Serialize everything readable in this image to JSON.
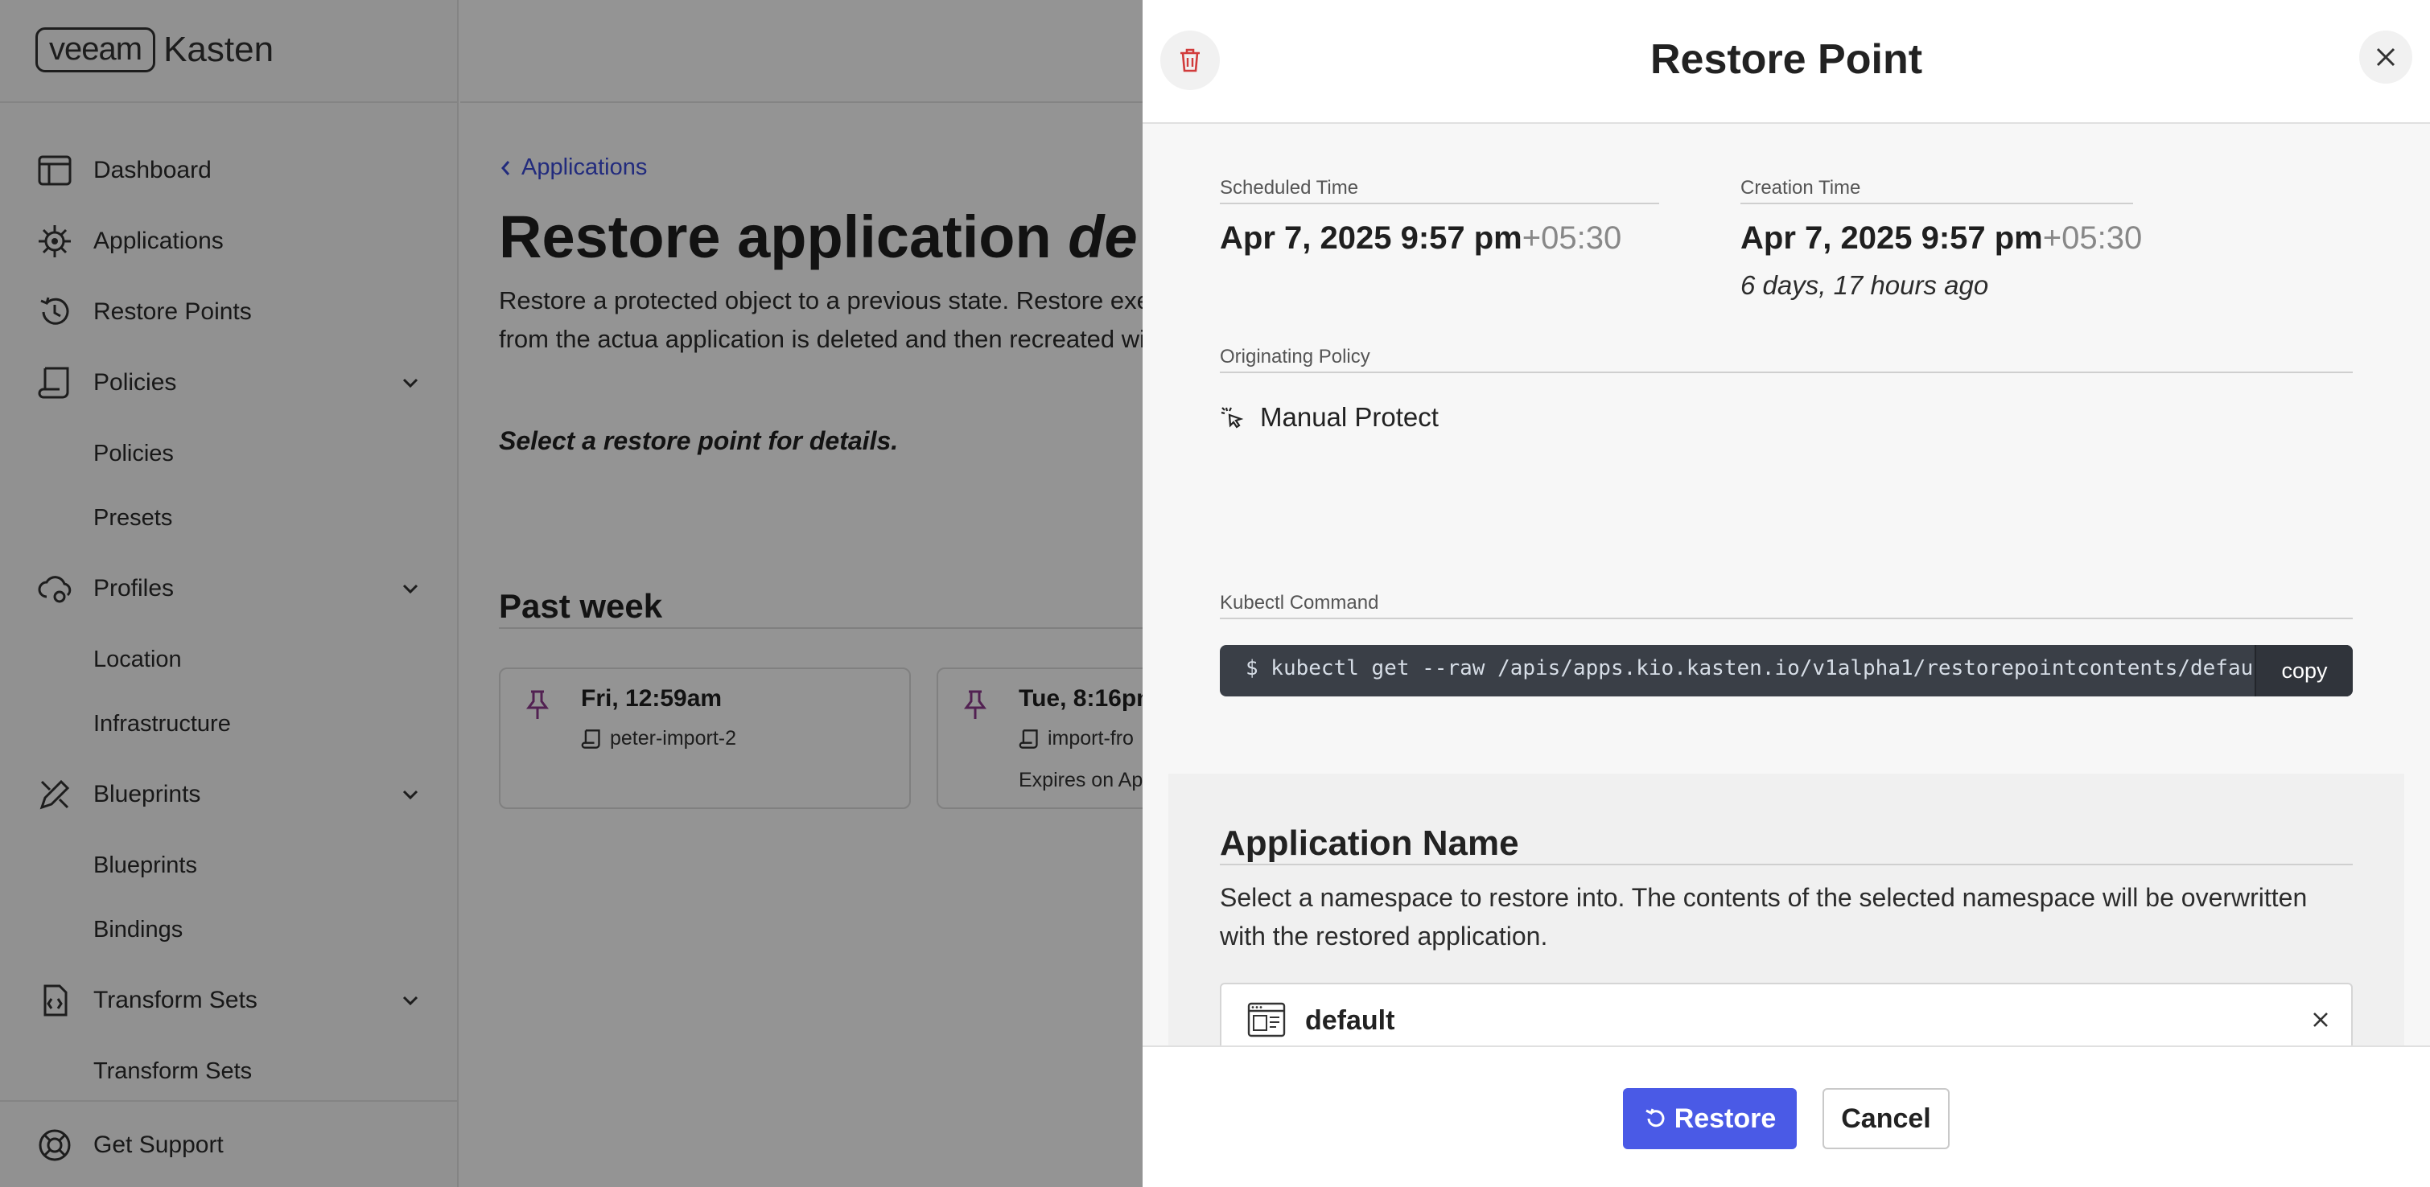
{
  "brand": {
    "logo_left": "veeam",
    "logo_right": "Kasten"
  },
  "sidebar": {
    "items": [
      {
        "label": "Dashboard"
      },
      {
        "label": "Applications"
      },
      {
        "label": "Restore Points"
      },
      {
        "label": "Policies"
      },
      {
        "label": "Profiles"
      },
      {
        "label": "Blueprints"
      },
      {
        "label": "Transform Sets"
      }
    ],
    "sub": {
      "policies": [
        "Policies",
        "Presets"
      ],
      "profiles": [
        "Location",
        "Infrastructure"
      ],
      "blueprints": [
        "Blueprints",
        "Bindings"
      ],
      "transform_sets": [
        "Transform Sets"
      ]
    },
    "support_label": "Get Support"
  },
  "main": {
    "breadcrumb": "Applications",
    "title_plain": "Restore application ",
    "title_italic": "de",
    "description": "Restore a protected object to a previous state. Restore execution time which may be different from the actua application is deleted and then recreated with the dat",
    "hint": "Select a restore point for details.",
    "section_title": "Past week",
    "cards": [
      {
        "time": "Fri, 12:59am",
        "policy": "peter-import-2",
        "expires": ""
      },
      {
        "time": "Tue, 8:16pm",
        "policy": "import-fro",
        "expires": "Expires on Ap"
      }
    ]
  },
  "drawer": {
    "title": "Restore Point",
    "scheduled_label": "Scheduled Time",
    "scheduled_date": "Apr 7, 2025 9:57 pm",
    "scheduled_tz": "+05:30",
    "creation_label": "Creation Time",
    "creation_date": "Apr 7, 2025 9:57 pm",
    "creation_tz": "+05:30",
    "creation_ago": "6 days, 17 hours ago",
    "policy_label": "Originating Policy",
    "policy_value": "Manual Protect",
    "kubectl_label": "Kubectl Command",
    "kubectl_command": "$ kubectl get --raw /apis/apps.kio.kasten.io/v1alpha1/restorepointcontents/default-",
    "copy_label": "copy",
    "app_name_title": "Application Name",
    "app_name_desc": "Select a namespace to restore into. The contents of the selected namespace will be overwritten with the restored application.",
    "namespace_value": "default",
    "restore_label": "Restore",
    "cancel_label": "Cancel"
  },
  "colors": {
    "accent": "#4a5ae6",
    "link": "#3b4bd8",
    "pin": "#8e3a8e",
    "danger": "#d13b3b",
    "code_bg": "#3a3f47"
  }
}
